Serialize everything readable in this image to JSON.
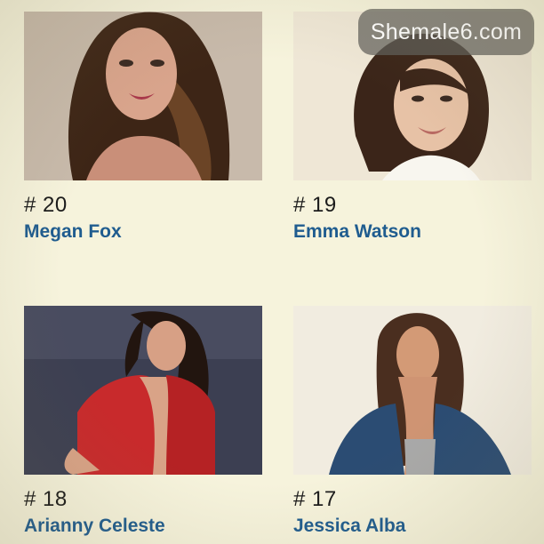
{
  "watermark": {
    "text": "Shemale6.com"
  },
  "cards": [
    {
      "rank": "# 20",
      "name": "Megan Fox"
    },
    {
      "rank": "# 19",
      "name": "Emma Watson"
    },
    {
      "rank": "# 18",
      "name": "Arianny Celeste"
    },
    {
      "rank": "# 17",
      "name": "Jessica Alba"
    }
  ],
  "colors": {
    "background": "#f6f3dc",
    "name_link": "#1f5c8f",
    "rank_text": "#1b1b1b"
  }
}
